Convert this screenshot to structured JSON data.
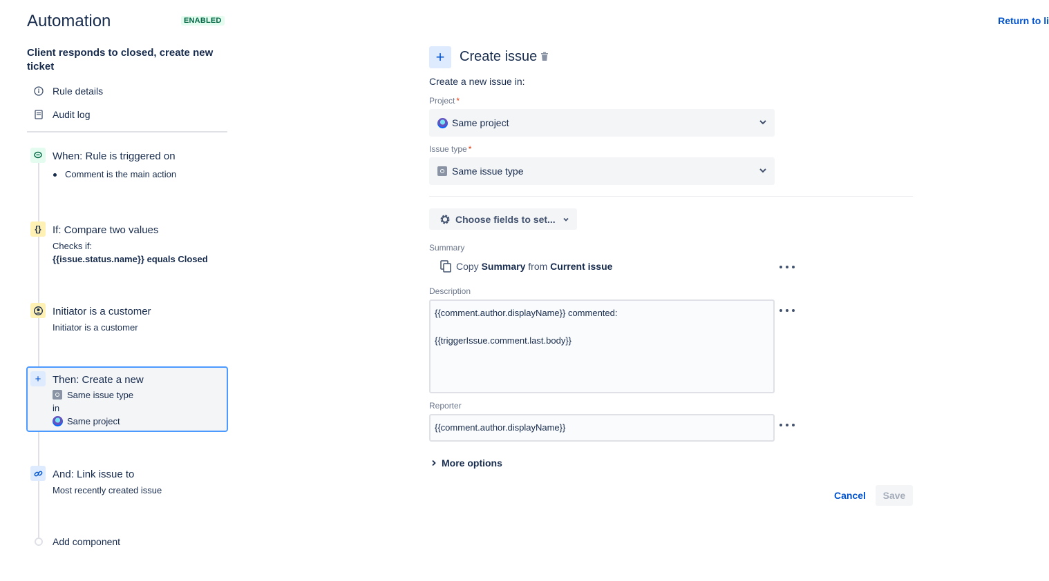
{
  "header": {
    "title": "Automation",
    "status_badge": "ENABLED",
    "return_link": "Return to li"
  },
  "sidebar": {
    "rule_name": "Client responds to closed, create new ticket",
    "nav": [
      {
        "label": "Rule details",
        "icon": "info-icon"
      },
      {
        "label": "Audit log",
        "icon": "document-icon"
      }
    ],
    "steps": [
      {
        "title": "When: Rule is triggered on",
        "bullet": "Comment is the main action",
        "icon": "comment-icon",
        "color": "#e3fcef"
      },
      {
        "title": "If: Compare two values",
        "line1": "Checks if:",
        "line2": "{{issue.status.name}} equals Closed",
        "icon": "braces-icon",
        "color": "#fff0b3"
      },
      {
        "title": "Initiator is a customer",
        "line1": "Initiator is a customer",
        "icon": "user-icon",
        "color": "#fff0b3"
      },
      {
        "title": "Then: Create a new",
        "line1": "Same issue type",
        "line2": "in",
        "line3": "Same project",
        "icon": "plus-icon",
        "color": "#deebff"
      },
      {
        "title": "And: Link issue to",
        "line1": "Most recently created issue",
        "icon": "link-icon",
        "color": "#deebff"
      }
    ],
    "add_component": "Add component"
  },
  "panel": {
    "title": "Create issue",
    "intro": "Create a new issue in:",
    "project_label": "Project",
    "project_value": "Same project",
    "issue_type_label": "Issue type",
    "issue_type_value": "Same issue type",
    "required_mark": "*",
    "choose_fields": "Choose fields to set...",
    "summary_label": "Summary",
    "summary": {
      "prefix": "Copy",
      "field": "Summary",
      "mid": "from",
      "source": "Current issue"
    },
    "description_label": "Description",
    "description_lines": [
      "{{comment.author.displayName}} commented:",
      "{{triggerIssue.comment.last.body}}"
    ],
    "reporter_label": "Reporter",
    "reporter_value": "{{comment.author.displayName}}",
    "more_options": "More options",
    "cancel": "Cancel",
    "save": "Save"
  }
}
